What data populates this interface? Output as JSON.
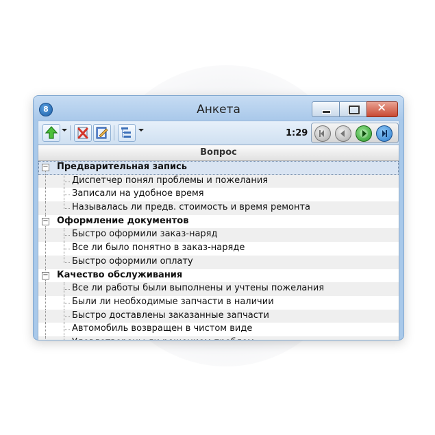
{
  "window": {
    "title": "Анкета",
    "timer": "1:29"
  },
  "toolbar": {
    "icons": [
      "arrow-up-icon",
      "delete-icon",
      "edit-icon",
      "tree-icon"
    ]
  },
  "table": {
    "column_header": "Вопрос",
    "groups": [
      {
        "label": "Предварительная запись",
        "items": [
          "Диспетчер понял проблемы и пожелания",
          "Записали на удобное время",
          "Называлась ли предв. стоимость и время ремонта"
        ]
      },
      {
        "label": "Оформление документов",
        "items": [
          "Быстро оформили заказ-наряд",
          "Все ли было понятно в заказ-наряде",
          "Быстро оформили оплату"
        ]
      },
      {
        "label": "Качество обслуживания",
        "items": [
          "Все ли работы были выполнены и учтены пожелания",
          "Были ли необходимые запчасти в наличии",
          "Быстро доставлены заказанные запчасти",
          "Автомобиль возвращен в чистом виде",
          "Удовлетворены ли решением проблем"
        ]
      }
    ]
  },
  "colors": {
    "window_frame": "#a9c9ea",
    "nav_green": "#3aa63a",
    "nav_blue": "#2f7fd0",
    "close_red": "#c94a33"
  }
}
